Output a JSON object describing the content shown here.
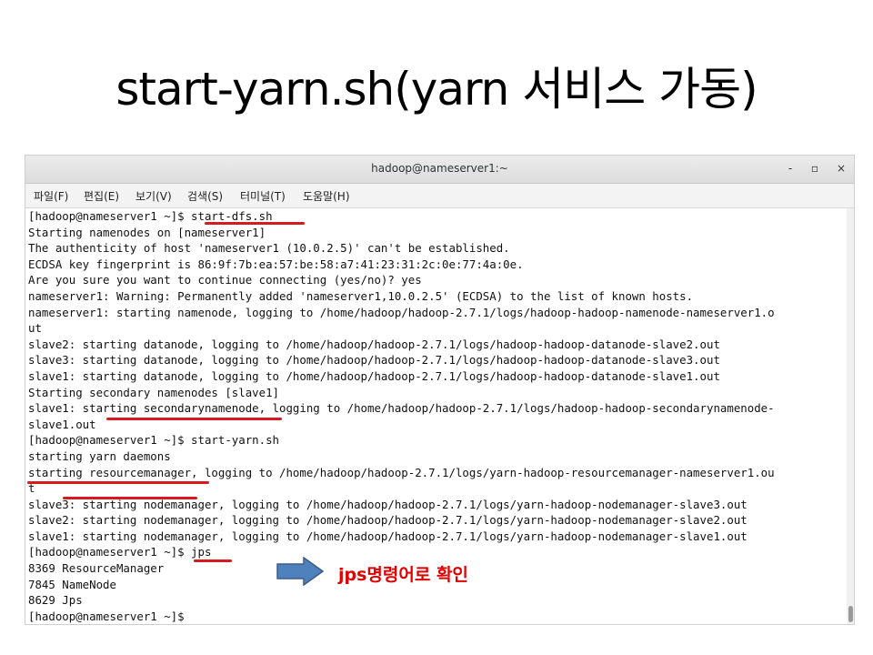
{
  "slide": {
    "title": "start-yarn.sh(yarn 서비스 가동)",
    "annotation": "jps명령어로 확인"
  },
  "window": {
    "title": "hadoop@nameserver1:~",
    "buttons": {
      "minimize": "-",
      "maximize": "▫",
      "close": "×"
    }
  },
  "menu": [
    "파일(F)",
    "편집(E)",
    "보기(V)",
    "검색(S)",
    "터미널(T)",
    "도움말(H)"
  ],
  "terminal": {
    "lines": [
      "[hadoop@nameserver1 ~]$ start-dfs.sh",
      "Starting namenodes on [nameserver1]",
      "The authenticity of host 'nameserver1 (10.0.2.5)' can't be established.",
      "ECDSA key fingerprint is 86:9f:7b:ea:57:be:58:a7:41:23:31:2c:0e:77:4a:0e.",
      "Are you sure you want to continue connecting (yes/no)? yes",
      "nameserver1: Warning: Permanently added 'nameserver1,10.0.2.5' (ECDSA) to the list of known hosts.",
      "nameserver1: starting namenode, logging to /home/hadoop/hadoop-2.7.1/logs/hadoop-hadoop-namenode-nameserver1.o",
      "ut",
      "slave2: starting datanode, logging to /home/hadoop/hadoop-2.7.1/logs/hadoop-hadoop-datanode-slave2.out",
      "slave3: starting datanode, logging to /home/hadoop/hadoop-2.7.1/logs/hadoop-hadoop-datanode-slave3.out",
      "slave1: starting datanode, logging to /home/hadoop/hadoop-2.7.1/logs/hadoop-hadoop-datanode-slave1.out",
      "Starting secondary namenodes [slave1]",
      "slave1: starting secondarynamenode, logging to /home/hadoop/hadoop-2.7.1/logs/hadoop-hadoop-secondarynamenode-",
      "slave1.out",
      "[hadoop@nameserver1 ~]$ start-yarn.sh",
      "starting yarn daemons",
      "starting resourcemanager, logging to /home/hadoop/hadoop-2.7.1/logs/yarn-hadoop-resourcemanager-nameserver1.ou",
      "t",
      "slave3: starting nodemanager, logging to /home/hadoop/hadoop-2.7.1/logs/yarn-hadoop-nodemanager-slave3.out",
      "slave2: starting nodemanager, logging to /home/hadoop/hadoop-2.7.1/logs/yarn-hadoop-nodemanager-slave2.out",
      "slave1: starting nodemanager, logging to /home/hadoop/hadoop-2.7.1/logs/yarn-hadoop-nodemanager-slave1.out",
      "[hadoop@nameserver1 ~]$ jps",
      "8369 ResourceManager",
      "7845 NameNode",
      "8629 Jps",
      "[hadoop@nameserver1 ~]$"
    ]
  },
  "colors": {
    "underline": "#d71920",
    "arrow": "#4f81bd",
    "annotation": "#e00000"
  }
}
